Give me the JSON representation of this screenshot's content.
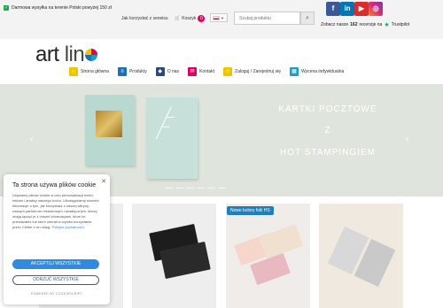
{
  "topbar": {
    "shipping": "Darmowa wysyłka na terenie Polski powyżej 150 zł",
    "how_to_buy": "Jak korzystać z serwisu",
    "cart_label": "Koszyk",
    "cart_count": "0",
    "search_placeholder": "Szukaj produktu",
    "reviews_prefix": "Zobacz nasze",
    "reviews_count": "162",
    "reviews_suffix": "recenzje na",
    "trustpilot": "Trustpilot",
    "social": [
      "f",
      "in",
      "▶",
      "◎"
    ]
  },
  "logo": {
    "art": "art",
    "line": "lin"
  },
  "nav": [
    {
      "label": "Strona główna",
      "color": "#f2c400",
      "icon": "home-icon"
    },
    {
      "label": "Produkty",
      "color": "#1d6fb8",
      "icon": "list-icon"
    },
    {
      "label": "O nas",
      "color": "#2b4a7a",
      "icon": "tag-icon"
    },
    {
      "label": "Kontakt",
      "color": "#e2005a",
      "icon": "mail-icon"
    },
    {
      "label": "Zaloguj / Zarejestruj się",
      "color": "#f2c400",
      "icon": "user-icon"
    },
    {
      "label": "Wycena indywidualna",
      "color": "#1aa0c8",
      "icon": "calc-icon"
    }
  ],
  "hero": {
    "line1": "KARTKI POCZTOWE",
    "line2": "Z",
    "line3": "HOT STAMPINGIEM"
  },
  "products": {
    "new_badge": "Nowe kolory folii HS"
  },
  "cookie": {
    "title": "Ta strona używa plików cookie",
    "body": "Używamy plików cookie w celu personalizacji treści, reklam i analizy naszego ruchu. Udostępniamy również informacje o tym, jak korzystasz z naszej witryny, naszym partnerom reklamowym i analitycznym, którzy mogą łączyć je z innymi informacjami, które im przekazałeś lub które zebrali w wyniku korzystania przez Ciebie z ich usług.",
    "policy": "Polityka prywatności",
    "accept": "AKCEPTUJ WSZYSTKIE",
    "reject": "ODRZUĆ WSZYSTKIE",
    "powered": "POWERED BY COOKIESCRIPT"
  },
  "colors": {
    "accept_btn": "#2f8ae0",
    "hero_bg": "#dfe5dc",
    "topbar_bg": "#f3f3f3"
  }
}
